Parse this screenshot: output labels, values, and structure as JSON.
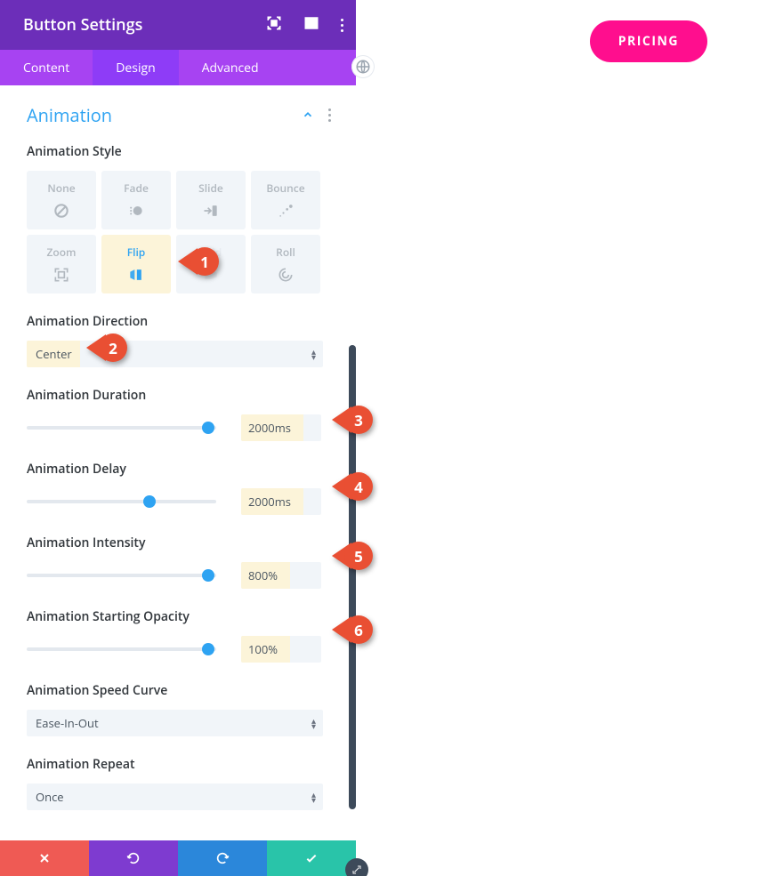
{
  "header": {
    "title": "Button Settings",
    "tabs": {
      "content": "Content",
      "design": "Design",
      "advanced": "Advanced"
    }
  },
  "section": {
    "title": "Animation"
  },
  "labels": {
    "style": "Animation Style",
    "direction": "Animation Direction",
    "duration": "Animation Duration",
    "delay": "Animation Delay",
    "intensity": "Animation Intensity",
    "opacity": "Animation Starting Opacity",
    "curve": "Animation Speed Curve",
    "repeat": "Animation Repeat"
  },
  "styles": {
    "none": "None",
    "fade": "Fade",
    "slide": "Slide",
    "bounce": "Bounce",
    "zoom": "Zoom",
    "flip": "Flip",
    "fold": "Fold",
    "roll": "Roll",
    "selected": "flip"
  },
  "values": {
    "direction": "Center",
    "duration": "2000ms",
    "delay": "2000ms",
    "intensity": "800%",
    "opacity": "100%",
    "curve": "Ease-In-Out",
    "repeat": "Once"
  },
  "slider_positions": {
    "duration": 96,
    "delay": 65,
    "intensity": 96,
    "opacity": 96
  },
  "callouts": {
    "c1": "1",
    "c2": "2",
    "c3": "3",
    "c4": "4",
    "c5": "5",
    "c6": "6"
  },
  "pricing": "PRICING"
}
